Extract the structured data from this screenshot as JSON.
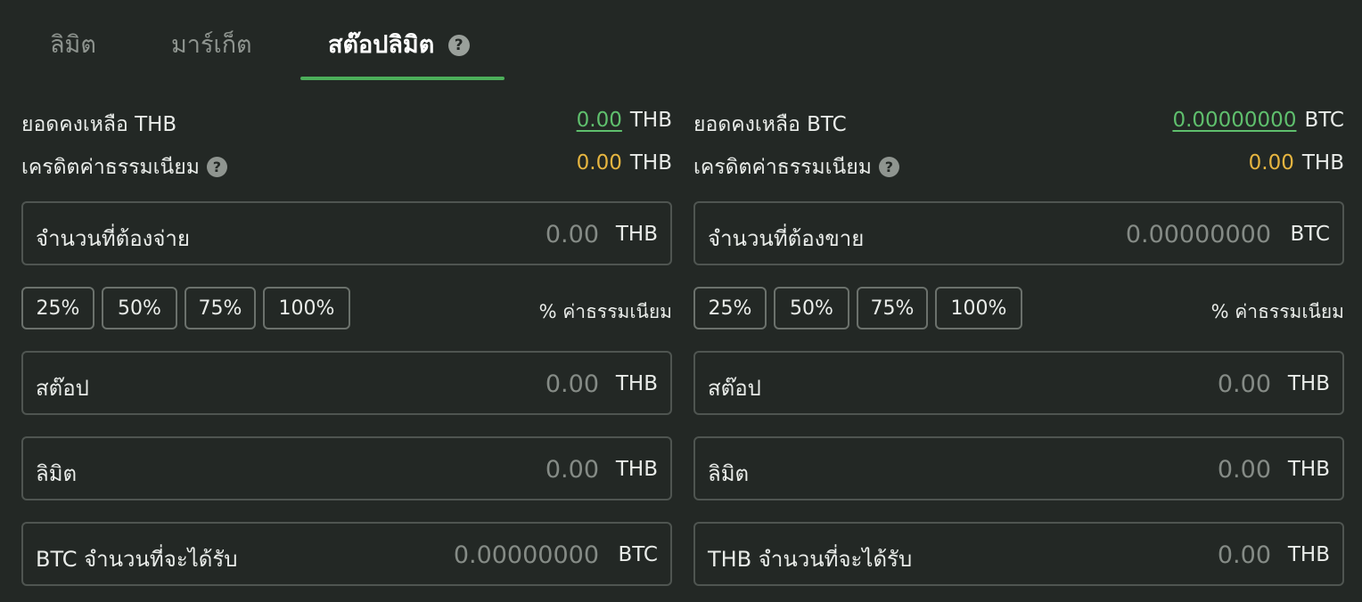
{
  "tabs": [
    {
      "label": "ลิมิต"
    },
    {
      "label": "มาร์เก็ต"
    },
    {
      "label": "สต๊อปลิมิต",
      "help": "?"
    }
  ],
  "colors": {
    "accent": "#4caf5a",
    "balance": "#5fbf6d",
    "fee": "#e6b540",
    "background": "#232825"
  },
  "buy": {
    "balance_label": "ยอดคงเหลือ THB",
    "balance_value": "0.00",
    "balance_unit": "THB",
    "fee_credit_label": "เครดิตค่าธรรมเนียม",
    "fee_credit_help": "?",
    "fee_credit_value": "0.00",
    "fee_credit_unit": "THB",
    "amount_label": "จำนวนที่ต้องจ่าย",
    "amount_placeholder": "0.00",
    "amount_unit": "THB",
    "percent_buttons": [
      "25%",
      "50%",
      "75%",
      "100%"
    ],
    "percent_note": "% ค่าธรรมเนียม",
    "stop_label": "สต๊อป",
    "stop_placeholder": "0.00",
    "stop_unit": "THB",
    "limit_label": "ลิมิต",
    "limit_placeholder": "0.00",
    "limit_unit": "THB",
    "receive_label": "BTC จำนวนที่จะได้รับ",
    "receive_placeholder": "0.00000000",
    "receive_unit": "BTC"
  },
  "sell": {
    "balance_label": "ยอดคงเหลือ BTC",
    "balance_value": "0.00000000",
    "balance_unit": "BTC",
    "fee_credit_label": "เครดิตค่าธรรมเนียม",
    "fee_credit_help": "?",
    "fee_credit_value": "0.00",
    "fee_credit_unit": "THB",
    "amount_label": "จำนวนที่ต้องขาย",
    "amount_placeholder": "0.00000000",
    "amount_unit": "BTC",
    "percent_buttons": [
      "25%",
      "50%",
      "75%",
      "100%"
    ],
    "percent_note": "% ค่าธรรมเนียม",
    "stop_label": "สต๊อป",
    "stop_placeholder": "0.00",
    "stop_unit": "THB",
    "limit_label": "ลิมิต",
    "limit_placeholder": "0.00",
    "limit_unit": "THB",
    "receive_label": "THB จำนวนที่จะได้รับ",
    "receive_placeholder": "0.00",
    "receive_unit": "THB"
  }
}
